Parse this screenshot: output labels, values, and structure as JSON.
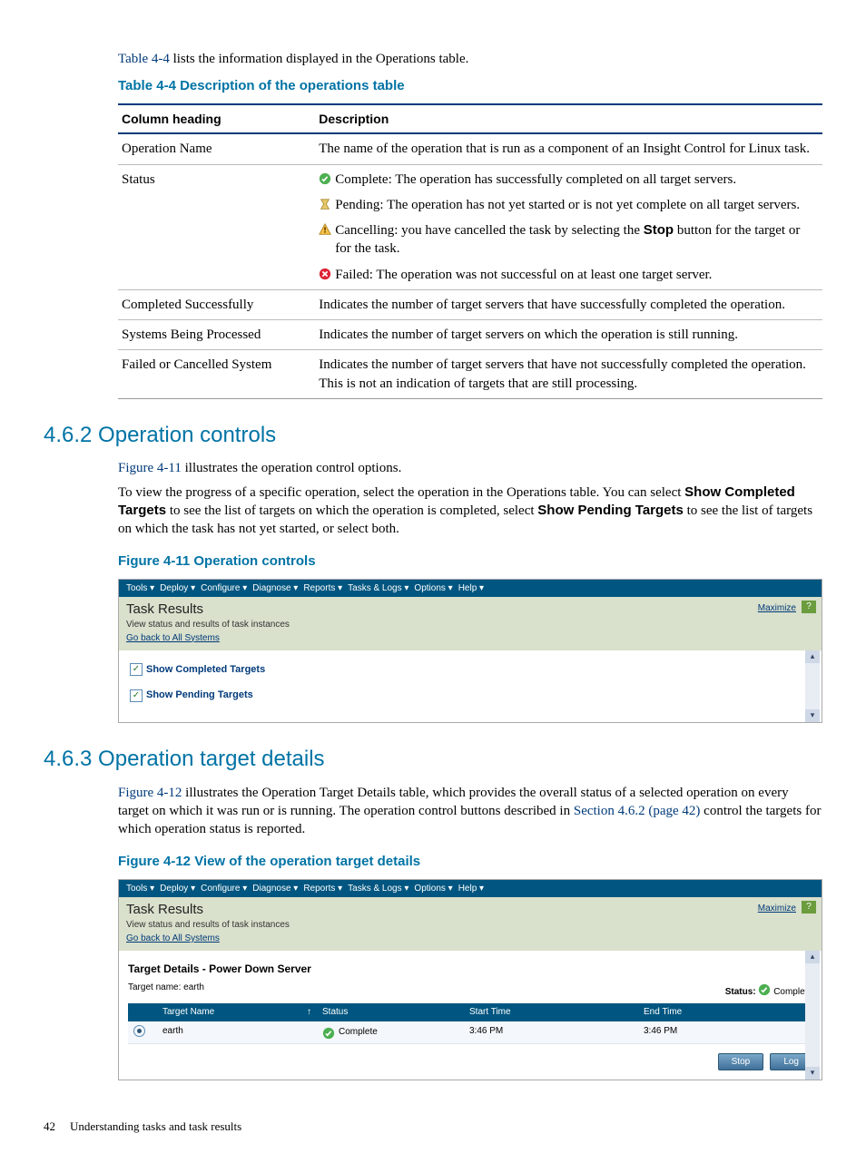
{
  "intro": {
    "link": "Table 4-4",
    "rest": " lists the information displayed in the Operations table."
  },
  "table44": {
    "caption": "Table 4-4 Description of the operations table",
    "head_col": "Column heading",
    "head_desc": "Description",
    "rows": [
      {
        "col": "Operation Name",
        "desc": "The name of the operation that is run as a component of an Insight Control for Linux task."
      },
      {
        "col": "Status"
      },
      {
        "col": "Completed Successfully",
        "desc": "Indicates the number of target servers that have successfully completed the operation."
      },
      {
        "col": "Systems Being Processed",
        "desc": "Indicates the number of target servers on which the operation is still running."
      },
      {
        "col": "Failed or Cancelled System",
        "desc": "Indicates the number of target servers that have not successfully completed the operation. This is not an indication of targets that are still processing."
      }
    ],
    "status": {
      "complete": "Complete: The operation has successfully completed on all target servers.",
      "pending": "Pending: The operation has not yet started or is not yet complete on all target servers.",
      "cancel_pre": "Cancelling: you have cancelled the task by selecting the ",
      "cancel_bold": "Stop",
      "cancel_post": " button for the target or for the task.",
      "failed": "Failed: The operation was not successful on at least one target server."
    }
  },
  "s462": {
    "heading": "4.6.2 Operation controls",
    "p1_link": "Figure 4-11",
    "p1_rest": " illustrates the operation control options.",
    "p2_a": "To view the progress of a specific operation, select the operation in the Operations table. You can select ",
    "p2_b1": "Show Completed Targets",
    "p2_c": " to see the list of targets on which the operation is completed, select ",
    "p2_b2": "Show Pending Targets",
    "p2_d": " to see the list of targets on which the task has not yet started, or select both."
  },
  "fig11": {
    "caption": "Figure 4-11 Operation controls",
    "menus": [
      "Tools ▾",
      "Deploy ▾",
      "Configure ▾",
      "Diagnose ▾",
      "Reports ▾",
      "Tasks & Logs ▾",
      "Options ▾",
      "Help ▾"
    ],
    "title": "Task Results",
    "sub": "View status and results of task instances",
    "goback": "Go back to All Systems",
    "maximize": "Maximize",
    "q": "?",
    "chk1": "Show Completed Targets",
    "chk2": "Show Pending Targets"
  },
  "s463": {
    "heading": "4.6.3 Operation target details",
    "p1_link": "Figure 4-12",
    "p1_a": " illustrates the Operation Target Details table, which provides the overall status of a selected operation on every target on which it was run or is running. The operation control buttons described in ",
    "p1_sec": "Section 4.6.2 (page 42)",
    "p1_b": " control the targets for which operation status is reported."
  },
  "fig12": {
    "caption": "Figure 4-12 View of the operation target details",
    "menus": [
      "Tools ▾",
      "Deploy ▾",
      "Configure ▾",
      "Diagnose ▾",
      "Reports ▾",
      "Tasks & Logs ▾",
      "Options ▾",
      "Help ▾"
    ],
    "title": "Task Results",
    "sub": "View status and results of task instances",
    "goback": "Go back to All Systems",
    "maximize": "Maximize",
    "q": "?",
    "target_heading": "Target Details - Power Down Server",
    "tname_label": "Target name: ",
    "tname_val": "earth",
    "status_lbl": "Status: ",
    "status_val": "Complete",
    "cols": {
      "name": "Target Name",
      "status": "Status",
      "start": "Start Time",
      "end": "End Time"
    },
    "row": {
      "name": "earth",
      "status": "Complete",
      "start": "3:46 PM",
      "end": "3:46 PM"
    },
    "stop_btn": "Stop",
    "log_btn": "Log"
  },
  "footer": {
    "page": "42",
    "chapter": "Understanding tasks and task results"
  }
}
